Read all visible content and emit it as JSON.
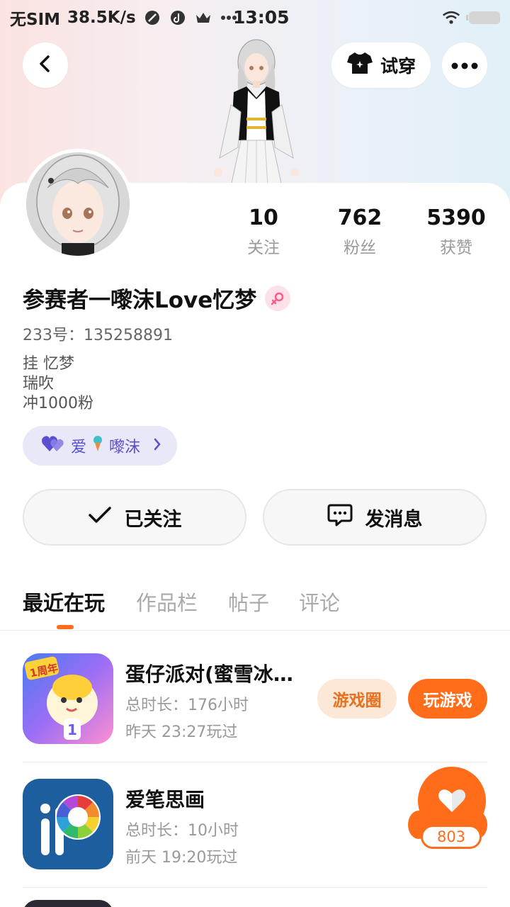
{
  "status_bar": {
    "carrier": "无SIM",
    "speed": "38.5K/s",
    "time": "13:05",
    "icons": [
      "no-signal-icon",
      "tiktok-icon",
      "crown-icon",
      "more-dots-icon",
      "wifi-icon",
      "battery-icon"
    ]
  },
  "top_nav": {
    "try_on_label": "试穿"
  },
  "profile": {
    "stats": [
      {
        "value": "10",
        "label": "关注"
      },
      {
        "value": "762",
        "label": "粉丝"
      },
      {
        "value": "5390",
        "label": "获赞"
      }
    ],
    "username": "参赛者一嚟沫Love忆梦",
    "uid": "233号：135258891",
    "bio_lines": [
      "挂 忆梦",
      "瑞吹",
      "冲1000粉"
    ],
    "fan_badge": {
      "prefix": "爱",
      "name": "嚟沫"
    }
  },
  "actions": {
    "follow_label": "已关注",
    "message_label": "发消息"
  },
  "tabs": [
    {
      "label": "最近在玩",
      "active": true
    },
    {
      "label": "作品栏",
      "active": false
    },
    {
      "label": "帖子",
      "active": false
    },
    {
      "label": "评论",
      "active": false
    }
  ],
  "games": [
    {
      "title": "蛋仔派对(蜜雪冰城...",
      "total_time": "总时长：176小时",
      "last_played": "昨天 23:27玩过",
      "circle_label": "游戏圈",
      "play_label": "玩游戏"
    },
    {
      "title": "爱笔思画",
      "total_time": "总时长：10小时",
      "last_played": "前天 19:20玩过"
    }
  ],
  "like_float": {
    "count": "803"
  },
  "colors": {
    "accent": "#ff6d1a",
    "badge_bg": "#e8e8f8",
    "badge_text": "#5a4fd0"
  }
}
